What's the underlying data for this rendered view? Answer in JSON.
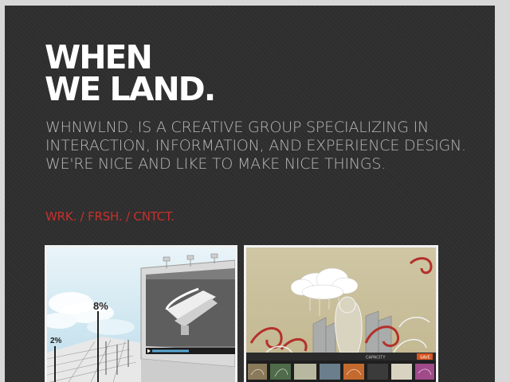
{
  "header": {
    "logo_line1": "WHEN",
    "logo_line2": "WE LAND.",
    "tagline": "WHNWLND. IS A CREATIVE GROUP SPECIALIZING IN INTERACTION, INFORMATION, AND EXPERIENCE DESIGN. WE'RE NICE AND LIKE TO MAKE NICE THINGS."
  },
  "nav": {
    "items": [
      "WRK.",
      "FRSH.",
      "CNTCT."
    ],
    "separator": "/",
    "color": "#c8302c"
  },
  "portfolio": {
    "thumb1": {
      "stat_large": "8%",
      "stat_small": "2%"
    },
    "thumb2": {
      "player_label": "CAPACITY",
      "button_label": "SAVE"
    }
  }
}
